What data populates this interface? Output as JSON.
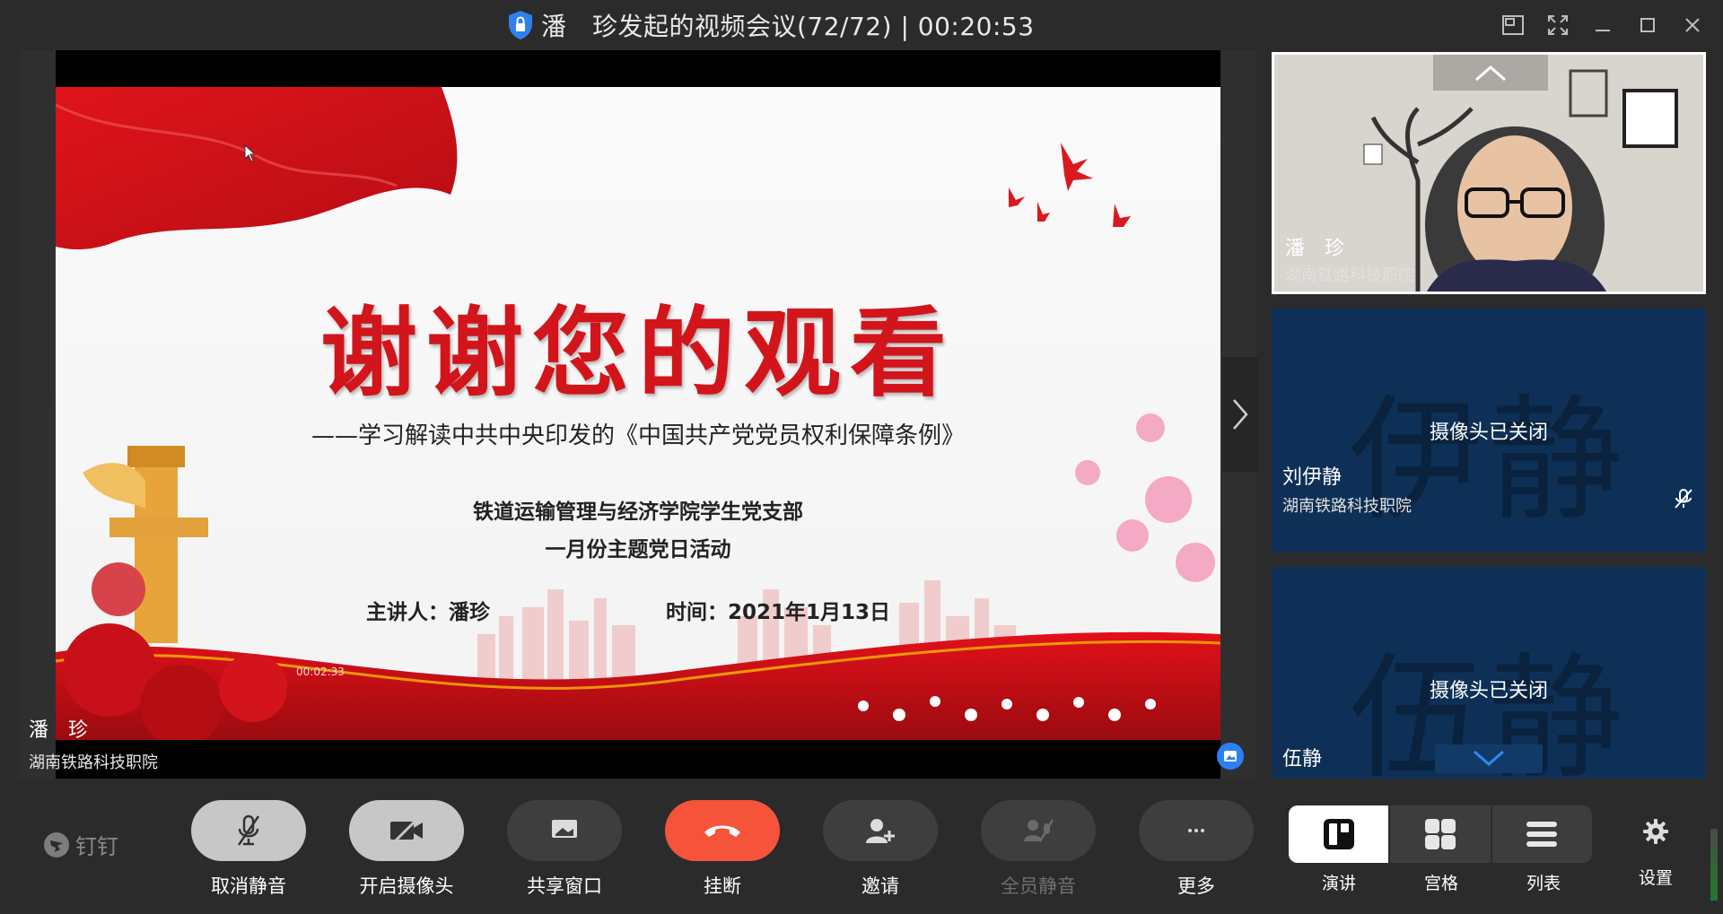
{
  "window": {
    "title": "潘　珍发起的视频会议(72/72)  | 00:20:53"
  },
  "slide": {
    "title": "谢谢您的观看",
    "subtitle": "——学习解读中共中央印发的《中国共产党党员权利保障条例》",
    "department": "铁道运输管理与经济学院学生党支部",
    "event": "一月份主题党日活动",
    "speaker": "主讲人：潘珍",
    "time": "时间：2021年1月13日",
    "timer_chip": "00:02:33"
  },
  "presenter": {
    "name": "潘　珍",
    "org": "湖南铁路科技职院"
  },
  "participants": [
    {
      "name": "潘　珍",
      "org": "湖南铁路科技职院",
      "video": true
    },
    {
      "name": "刘伊静",
      "org": "湖南铁路科技职院",
      "avatar_text": "伊静",
      "status": "摄像头已关闭",
      "muted": true
    },
    {
      "name": "伍静",
      "avatar_text": "伍静",
      "status": "摄像头已关闭"
    }
  ],
  "toolbar": {
    "brand": "钉钉",
    "controls": [
      {
        "label": "取消静音",
        "icon": "mic-muted-icon"
      },
      {
        "label": "开启摄像头",
        "icon": "camera-off-icon"
      },
      {
        "label": "共享窗口",
        "icon": "share-screen-icon"
      },
      {
        "label": "挂断",
        "icon": "hang-up-icon"
      },
      {
        "label": "邀请",
        "icon": "add-user-icon"
      },
      {
        "label": "全员静音",
        "icon": "mute-all-icon",
        "disabled": true
      },
      {
        "label": "更多",
        "icon": "more-icon"
      }
    ],
    "layouts": [
      {
        "label": "演讲",
        "icon": "speaker-layout-icon",
        "selected": true
      },
      {
        "label": "宫格",
        "icon": "grid-layout-icon"
      },
      {
        "label": "列表",
        "icon": "list-layout-icon"
      }
    ],
    "settings_label": "设置"
  },
  "colors": {
    "background": "#2b2b2b",
    "hangup": "#f5543a",
    "cam_off_tile": "#0e3057",
    "slide_title": "#d2141b"
  }
}
